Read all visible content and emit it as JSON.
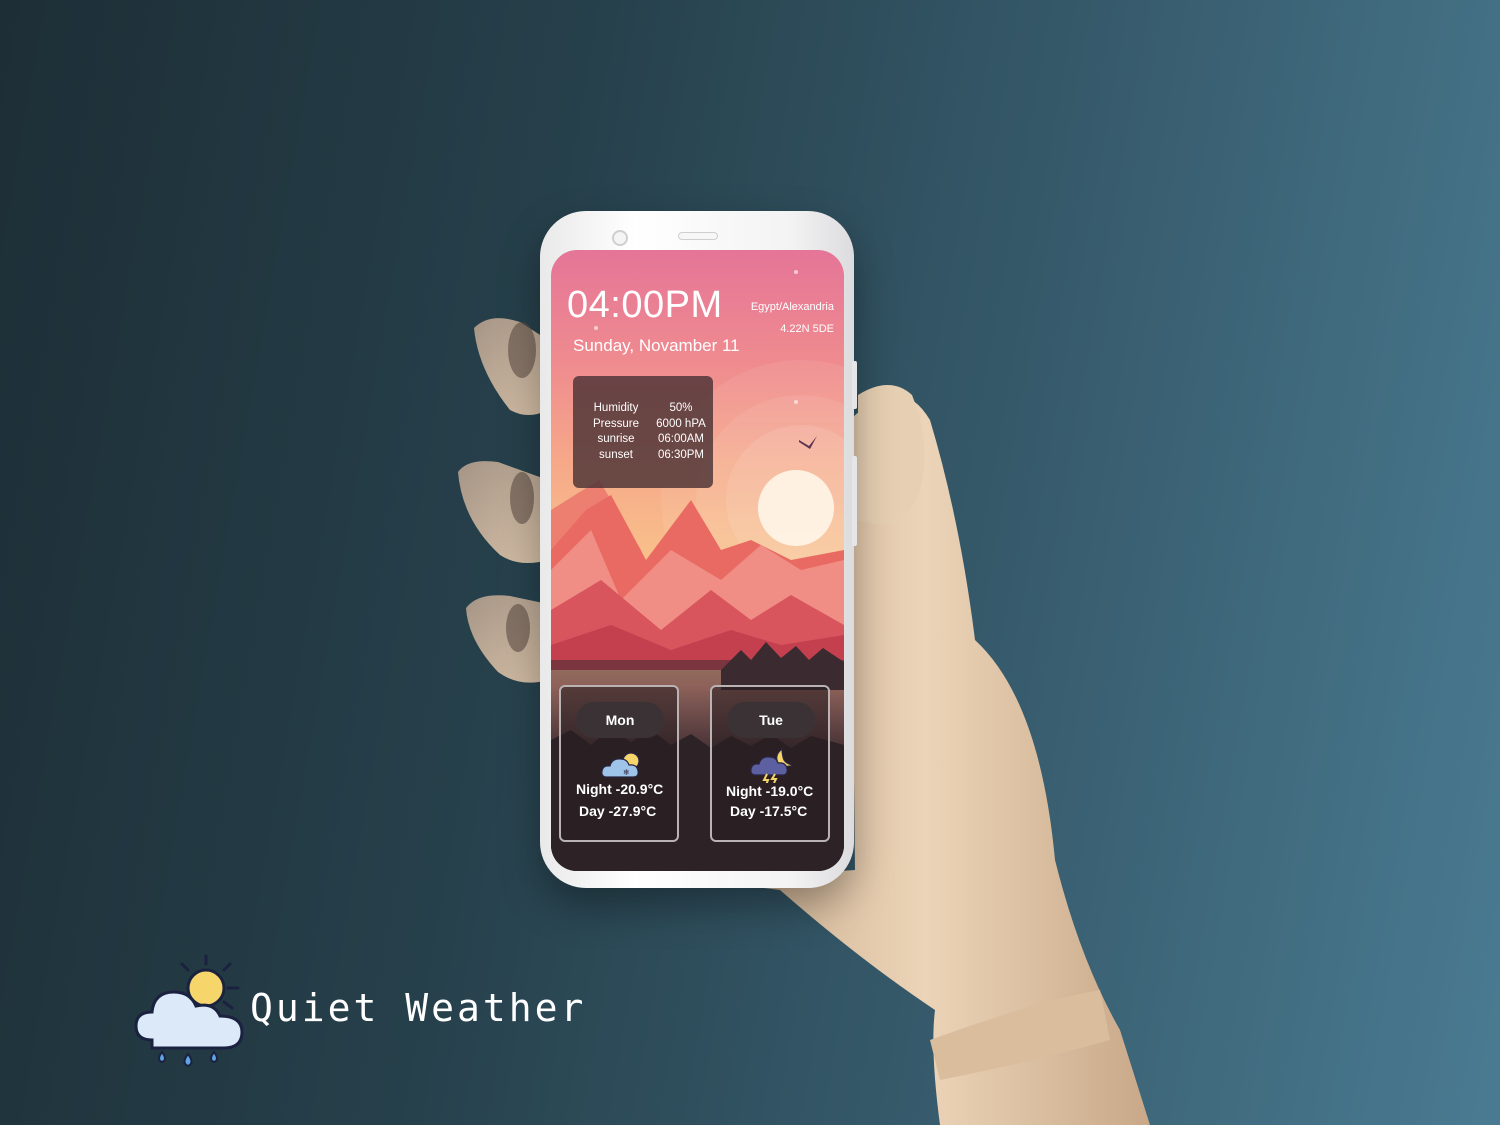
{
  "app": {
    "name": "Quiet Weather"
  },
  "weather": {
    "time": "04:00PM",
    "date": "Sunday, Novamber 11",
    "location": "Egypt/Alexandria",
    "coordinates": "4.22N 5DE"
  },
  "details": {
    "rows": [
      {
        "label": "Humidity",
        "value": "50%"
      },
      {
        "label": "Pressure",
        "value": "6000 hPA"
      },
      {
        "label": "sunrise",
        "value": "06:00AM"
      },
      {
        "label": "sunset",
        "value": "06:30PM"
      }
    ]
  },
  "forecast": [
    {
      "day": "Mon",
      "night": "Night -20.9°C",
      "daytemp": "Day -27.9°C",
      "icon": "cloud-snow-sun-icon"
    },
    {
      "day": "Tue",
      "night": "Night -19.0°C",
      "daytemp": "Day -17.5°C",
      "icon": "cloud-thunder-moon-icon"
    }
  ],
  "colors": {
    "background_dark": "#1d2e36",
    "background_light": "#4a7b92",
    "sky_pink": "#e57598",
    "sky_orange": "#f6a889",
    "card_bg": "#3a3234"
  }
}
